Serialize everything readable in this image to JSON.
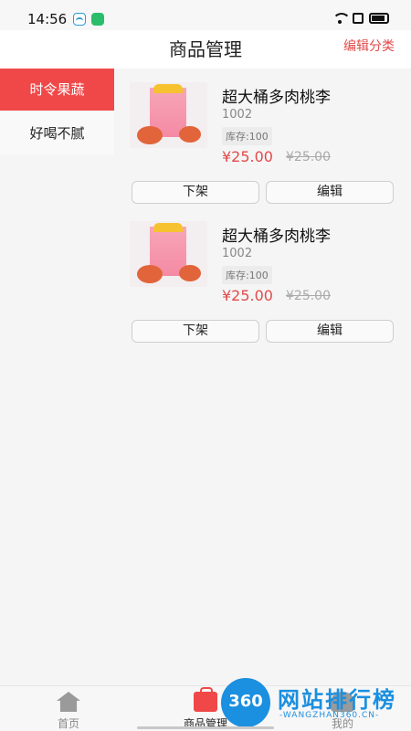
{
  "status": {
    "time": "14:56"
  },
  "header": {
    "title": "商品管理",
    "edit_category": "编辑分类"
  },
  "sidebar": {
    "items": [
      {
        "label": "时令果蔬"
      },
      {
        "label": "好喝不腻"
      }
    ]
  },
  "products": [
    {
      "name": "超大桶多肉桃李",
      "code": "1002",
      "stock": "库存:100",
      "price": "¥25.00",
      "orig_price": "¥25.00",
      "off_label": "下架",
      "edit_label": "编辑"
    },
    {
      "name": "超大桶多肉桃李",
      "code": "1002",
      "stock": "库存:100",
      "price": "¥25.00",
      "orig_price": "¥25.00",
      "off_label": "下架",
      "edit_label": "编辑"
    }
  ],
  "tabbar": {
    "items": [
      {
        "label": "首页",
        "icon": "home-icon"
      },
      {
        "label": "商品管理",
        "icon": "bag-icon"
      },
      {
        "label": "我的",
        "icon": "user-icon"
      }
    ]
  },
  "watermark": {
    "badge": "360",
    "text": "网站排行榜",
    "sub": "-WANGZHAN360.CN-"
  },
  "colors": {
    "accent": "#f04848",
    "price": "#e14a4a"
  }
}
